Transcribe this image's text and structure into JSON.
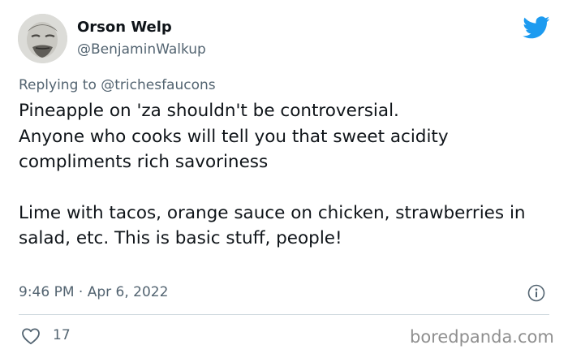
{
  "tweet": {
    "author": {
      "display_name": "Orson Welp",
      "handle": "@BenjaminWalkup"
    },
    "reply_to": {
      "prefix": "Replying to",
      "mention": "@trichesfaucons"
    },
    "paragraphs": [
      "Pineapple on 'za shouldn't be controversial.\nAnyone who cooks will tell you that sweet acidity compliments rich savoriness",
      "Lime with tacos, orange sauce on chicken, strawberries in salad, etc. This is basic stuff, people!"
    ],
    "timestamp": "9:46 PM · Apr 6, 2022",
    "likes": "17"
  },
  "icons": {
    "brand": "twitter-bird-icon",
    "info": "info-icon",
    "like": "heart-icon"
  },
  "colors": {
    "twitter_blue": "#1d9bf0",
    "secondary_text": "#536471",
    "divider": "#cfd9de",
    "watermark": "#8f8f8f"
  },
  "watermark": "boredpanda.com"
}
